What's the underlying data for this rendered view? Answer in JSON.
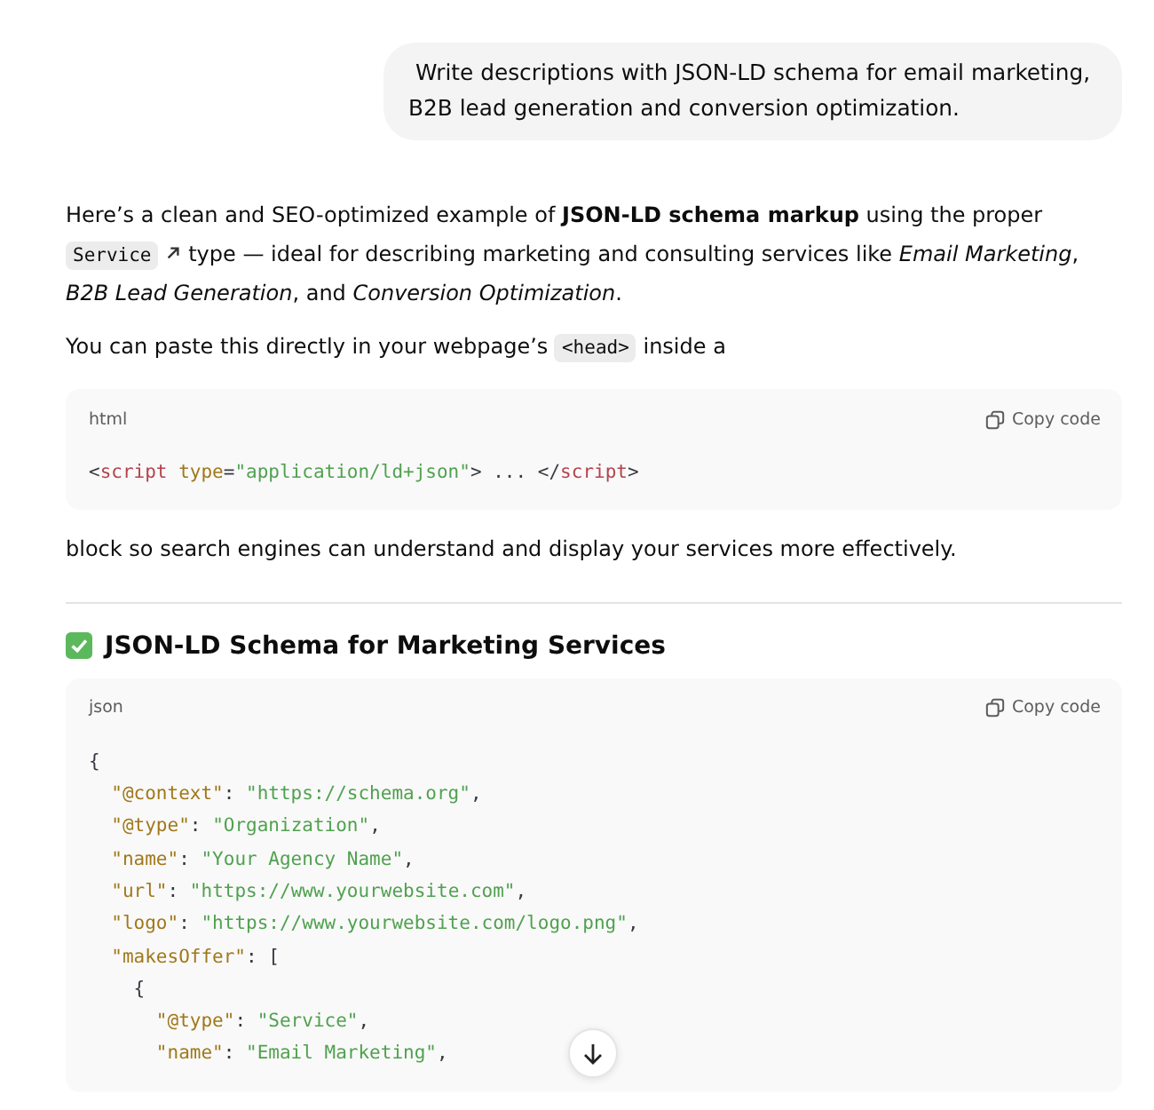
{
  "user_message": {
    "text": " Write descriptions with JSON-LD schema for email marketing, B2B lead generation and conversion optimization."
  },
  "reply": [
    {
      "kind": "paragraph",
      "parts": [
        {
          "kind": "text",
          "text": "Here’s a clean and SEO-optimized example of **JSON-LD schema markup** using the proper "
        },
        {
          "kind": "link_code",
          "text": "Service"
        },
        {
          "kind": "text",
          "text": " type — ideal for describing marketing and consulting services like *Email Marketing*, *B2B Lead Generation*, and *Conversion Optimization*."
        }
      ]
    },
    {
      "kind": "paragraph",
      "parts": [
        {
          "kind": "text",
          "text": "You can paste this directly in your webpage’s "
        },
        {
          "kind": "code",
          "text": "<head>"
        },
        {
          "kind": "text",
          "text": " inside a"
        }
      ]
    },
    {
      "kind": "code_block",
      "language": "html",
      "copy_label": "Copy code",
      "lines": [
        [
          {
            "kind": "punct",
            "text": "<"
          },
          {
            "kind": "tag",
            "text": "script"
          },
          {
            "kind": "attr",
            "text": " type"
          },
          {
            "kind": "punct",
            "text": "="
          },
          {
            "kind": "string",
            "text": "\"application/ld+json\""
          },
          {
            "kind": "punct",
            "text": "> ... </"
          },
          {
            "kind": "tag",
            "text": "script"
          },
          {
            "kind": "punct",
            "text": ">"
          }
        ]
      ]
    },
    {
      "kind": "paragraph",
      "parts": [
        {
          "kind": "text",
          "text": "block so search engines can understand and display your services more effectively."
        }
      ]
    },
    {
      "kind": "divider"
    },
    {
      "kind": "heading",
      "text": "JSON-LD Schema for Marketing Services"
    },
    {
      "kind": "code_block",
      "language": "json",
      "copy_label": "Copy code",
      "lines": [
        [
          {
            "kind": "punct",
            "text": "{"
          }
        ],
        [
          {
            "kind": "key",
            "text": "  \"@context\""
          },
          {
            "kind": "punct",
            "text": ": "
          },
          {
            "kind": "string",
            "text": "\"https://schema.org\""
          },
          {
            "kind": "punct",
            "text": ","
          }
        ],
        [
          {
            "kind": "key",
            "text": "  \"@type\""
          },
          {
            "kind": "punct",
            "text": ": "
          },
          {
            "kind": "string",
            "text": "\"Organization\""
          },
          {
            "kind": "punct",
            "text": ","
          }
        ],
        [
          {
            "kind": "key",
            "text": "  \"name\""
          },
          {
            "kind": "punct",
            "text": ": "
          },
          {
            "kind": "string",
            "text": "\"Your Agency Name\""
          },
          {
            "kind": "punct",
            "text": ","
          }
        ],
        [
          {
            "kind": "key",
            "text": "  \"url\""
          },
          {
            "kind": "punct",
            "text": ": "
          },
          {
            "kind": "string",
            "text": "\"https://www.yourwebsite.com\""
          },
          {
            "kind": "punct",
            "text": ","
          }
        ],
        [
          {
            "kind": "key",
            "text": "  \"logo\""
          },
          {
            "kind": "punct",
            "text": ": "
          },
          {
            "kind": "string",
            "text": "\"https://www.yourwebsite.com/logo.png\""
          },
          {
            "kind": "punct",
            "text": ","
          }
        ],
        [
          {
            "kind": "key",
            "text": "  \"makesOffer\""
          },
          {
            "kind": "punct",
            "text": ": ["
          }
        ],
        [
          {
            "kind": "punct",
            "text": "    {"
          }
        ],
        [
          {
            "kind": "key",
            "text": "      \"@type\""
          },
          {
            "kind": "punct",
            "text": ": "
          },
          {
            "kind": "string",
            "text": "\"Service\""
          },
          {
            "kind": "punct",
            "text": ","
          }
        ],
        [
          {
            "kind": "key",
            "text": "      \"name\""
          },
          {
            "kind": "punct",
            "text": ": "
          },
          {
            "kind": "string",
            "text": "\"Email Marketing\""
          },
          {
            "kind": "punct",
            "text": ","
          }
        ]
      ]
    }
  ]
}
